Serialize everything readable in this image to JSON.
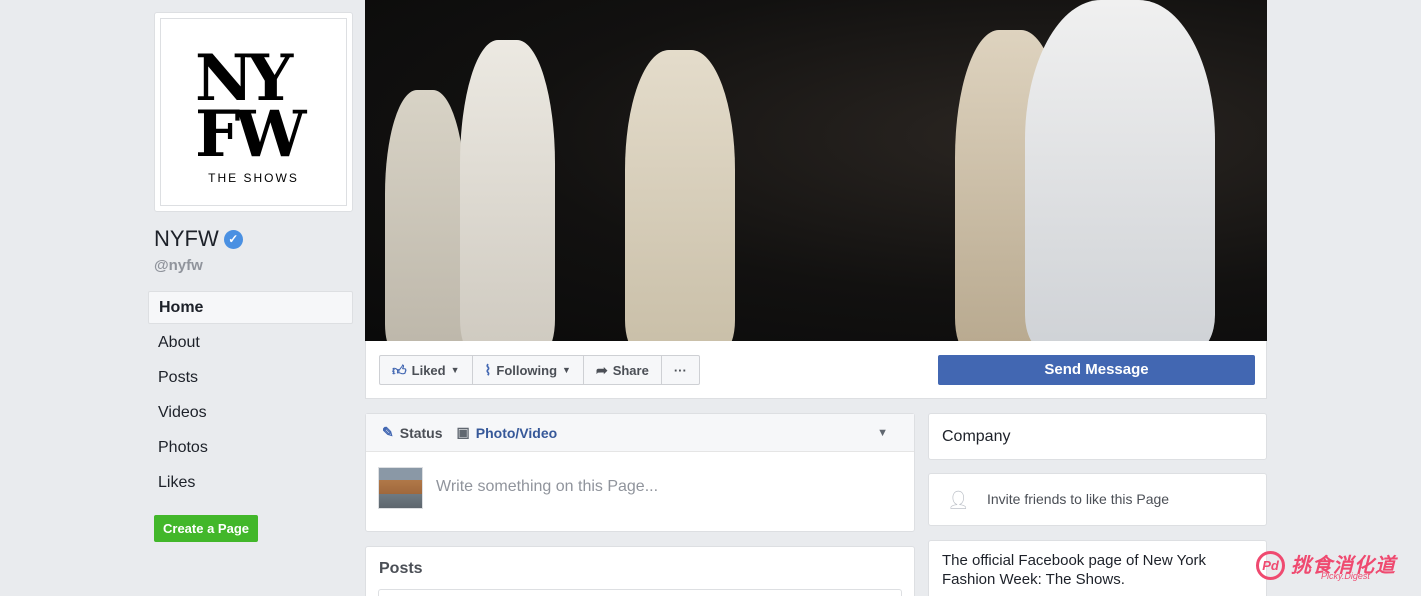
{
  "profile": {
    "logo_line1": "NY",
    "logo_line2": "FW",
    "logo_sub": "THE SHOWS",
    "name": "NYFW",
    "verified_icon": "verified-check-icon",
    "handle": "@nyfw"
  },
  "nav": {
    "items": [
      {
        "label": "Home",
        "active": true
      },
      {
        "label": "About"
      },
      {
        "label": "Posts"
      },
      {
        "label": "Videos"
      },
      {
        "label": "Photos"
      },
      {
        "label": "Likes"
      }
    ],
    "create_page_label": "Create a Page"
  },
  "actions": {
    "liked_label": "Liked",
    "following_label": "Following",
    "share_label": "Share",
    "more_label": "···",
    "send_message_label": "Send Message"
  },
  "composer": {
    "status_label": "Status",
    "photo_label": "Photo/Video",
    "placeholder": "Write something on this Page..."
  },
  "posts": {
    "title": "Posts"
  },
  "sidebar": {
    "category": "Company",
    "invite_text": "Invite friends to like this Page",
    "about_text": "The official Facebook page of New York Fashion Week: The Shows."
  },
  "watermark": {
    "text": "挑食消化道",
    "sub": "Picky.Digest",
    "badge": "Pd"
  },
  "colors": {
    "facebook_blue": "#4267b2",
    "create_green": "#42b72a",
    "link_blue": "#365899",
    "page_bg": "#e9ebee",
    "watermark_pink": "#ef4a70"
  }
}
